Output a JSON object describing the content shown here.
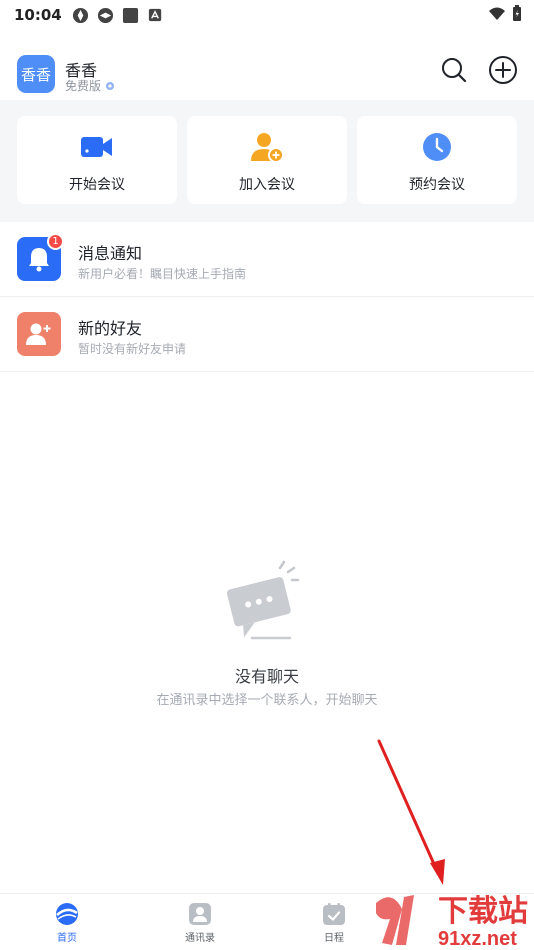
{
  "status_bar": {
    "time": "10:04"
  },
  "header": {
    "avatar_text": "香香",
    "user_name": "香香",
    "plan": "免费版"
  },
  "quick_actions": [
    {
      "label": "开始会议",
      "icon": "video-camera-icon",
      "color": "#2b6cf6"
    },
    {
      "label": "加入会议",
      "icon": "add-person-icon",
      "color": "#f5a623"
    },
    {
      "label": "预约会议",
      "icon": "clock-icon",
      "color": "#4f8ef7"
    }
  ],
  "list": [
    {
      "title": "消息通知",
      "subtitle": "新用户必看！瞩目快速上手指南",
      "badge": "1",
      "icon": "bell-icon",
      "color": "#2b6cf6"
    },
    {
      "title": "新的好友",
      "subtitle": "暂时没有新好友申请",
      "icon": "add-friend-icon",
      "color": "#ef8069"
    }
  ],
  "empty_state": {
    "title": "没有聊天",
    "subtitle": "在通讯录中选择一个联系人，开始聊天"
  },
  "bottom_nav": [
    {
      "label": "首页",
      "icon": "home-icon",
      "active": true
    },
    {
      "label": "通讯录",
      "icon": "contacts-icon",
      "active": false
    },
    {
      "label": "日程",
      "icon": "calendar-icon",
      "active": false
    }
  ],
  "watermark": {
    "brand": "下载站",
    "domain": "91xz.net"
  },
  "colors": {
    "accent": "#2b6cf6",
    "badge": "#f54a45",
    "annotation_arrow": "#e02020"
  }
}
